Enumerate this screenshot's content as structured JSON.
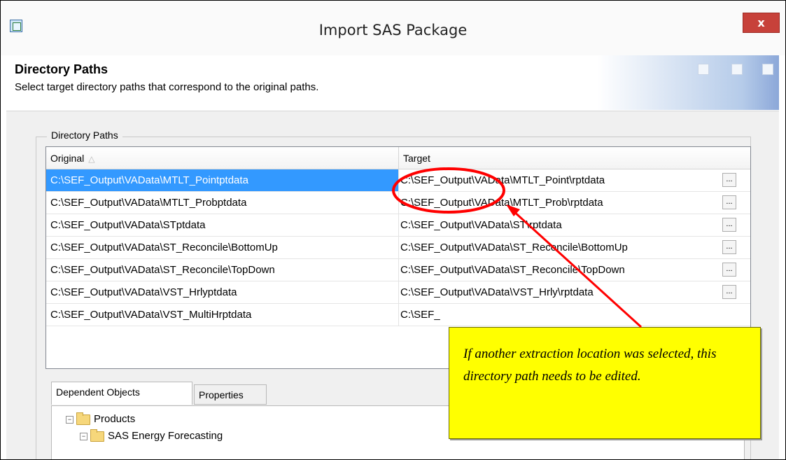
{
  "window": {
    "title": "Import SAS Package",
    "close_label": "x"
  },
  "banner": {
    "heading": "Directory Paths",
    "subtext": "Select target directory paths that correspond to the original paths."
  },
  "group": {
    "label": "Directory Paths"
  },
  "grid": {
    "columns": {
      "original": "Original",
      "target": "Target"
    },
    "browse_label": "...",
    "rows": [
      {
        "original": "C:\\SEF_Output\\VAData\\MTLT_Pointptdata",
        "target": "C:\\SEF_Output\\VAData\\MTLT_Point\\rptdata"
      },
      {
        "original": "C:\\SEF_Output\\VAData\\MTLT_Probptdata",
        "target": "C:\\SEF_Output\\VAData\\MTLT_Prob\\rptdata"
      },
      {
        "original": "C:\\SEF_Output\\VAData\\STptdata",
        "target": "C:\\SEF_Output\\VAData\\ST\\rptdata"
      },
      {
        "original": "C:\\SEF_Output\\VAData\\ST_Reconcile\\BottomUp",
        "target": "C:\\SEF_Output\\VAData\\ST_Reconcile\\BottomUp"
      },
      {
        "original": "C:\\SEF_Output\\VAData\\ST_Reconcile\\TopDown",
        "target": "C:\\SEF_Output\\VAData\\ST_Reconcile\\TopDown"
      },
      {
        "original": "C:\\SEF_Output\\VAData\\VST_Hrlyptdata",
        "target": "C:\\SEF_Output\\VAData\\VST_Hrly\\rptdata"
      },
      {
        "original": "C:\\SEF_Output\\VAData\\VST_MultiHrptdata",
        "target": "C:\\SEF_"
      }
    ]
  },
  "tabs": [
    {
      "label": "Dependent Objects"
    },
    {
      "label": "Properties"
    }
  ],
  "tree": {
    "items": [
      {
        "label": "Products"
      },
      {
        "label": "SAS Energy Forecasting"
      }
    ]
  },
  "callout": {
    "text": "If another extraction location was selected, this directory path needs to be edited."
  },
  "colors": {
    "selection": "#3399ff",
    "close_button": "#c7413a",
    "callout_fill": "#ffff00",
    "annotation": "#ff0000"
  }
}
